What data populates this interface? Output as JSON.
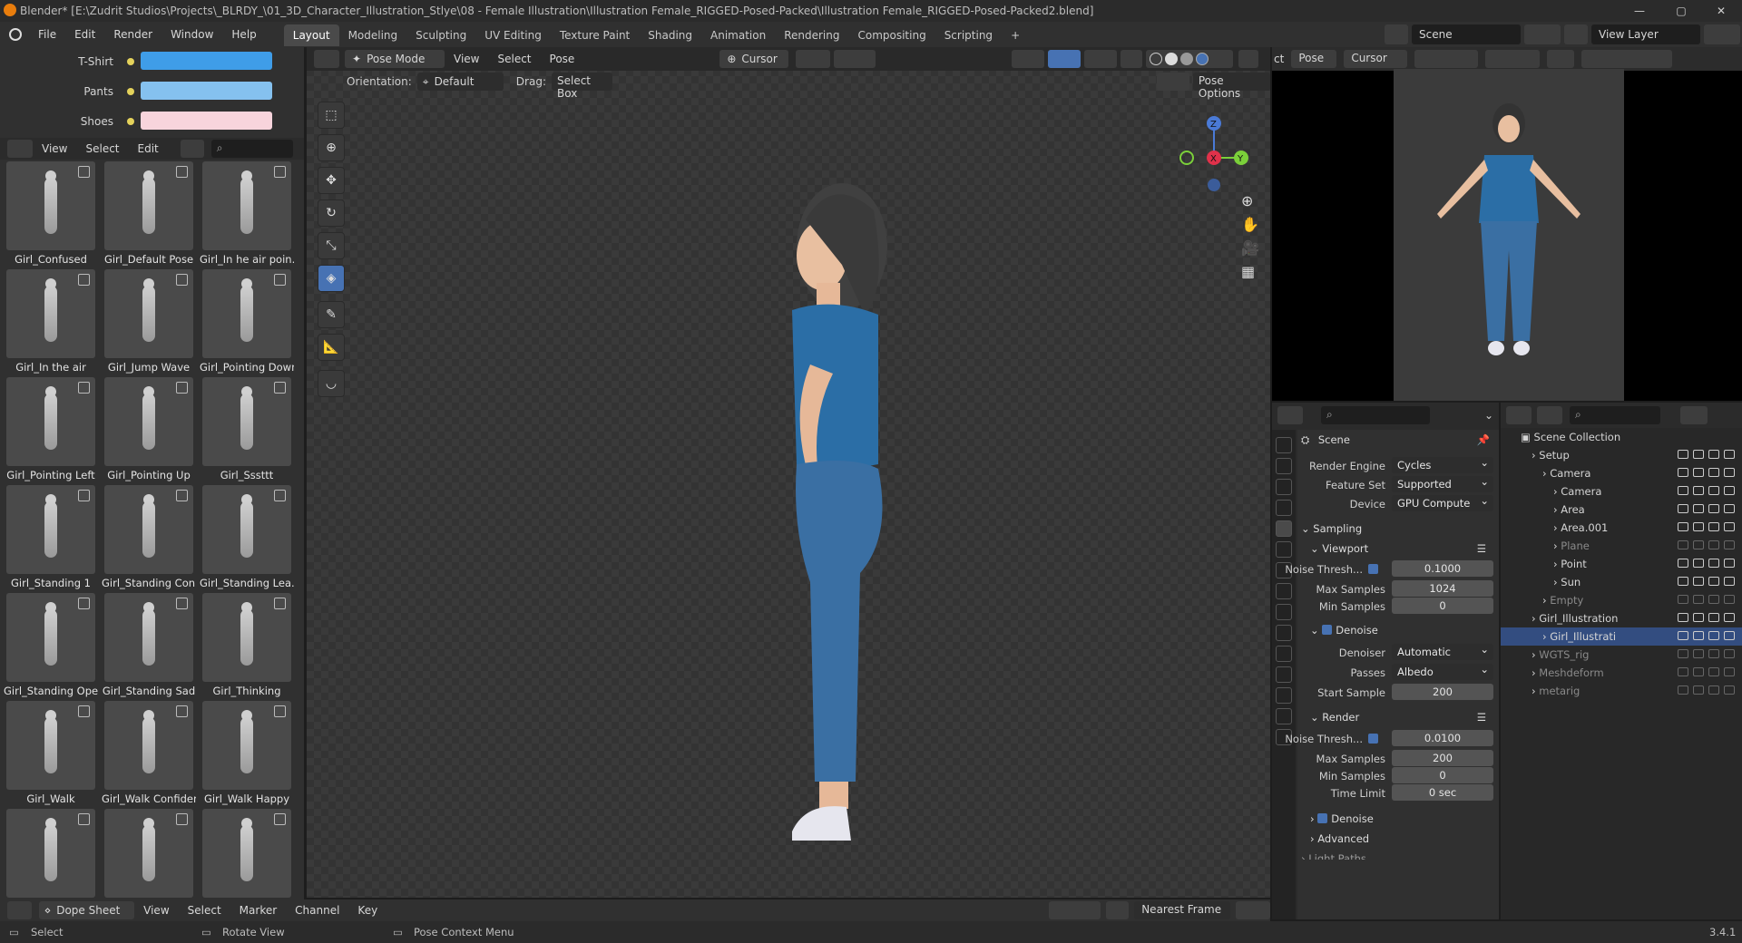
{
  "window": {
    "title": "Blender* [E:\\Zudrit Studios\\Projects\\_BLRDY_\\01_3D_Character_Illustration_Stlye\\08 - Female Illustration\\Illustration Female_RIGGED-Posed-Packed\\Illustration Female_RIGGED-Posed-Packed2.blend]",
    "minimize": "—",
    "maximize": "▢",
    "close": "✕"
  },
  "menubar": {
    "menus": [
      "File",
      "Edit",
      "Render",
      "Window",
      "Help"
    ],
    "workspaces": [
      "Layout",
      "Modeling",
      "Sculpting",
      "UV Editing",
      "Texture Paint",
      "Shading",
      "Animation",
      "Rendering",
      "Compositing",
      "Scripting"
    ],
    "active_workspace": "Layout",
    "add_tab": "+",
    "scene_label": "Scene",
    "view_layer_label": "View Layer"
  },
  "colors_panel": {
    "rows": [
      {
        "label": "T-Shirt",
        "color": "#3f9de8"
      },
      {
        "label": "Pants",
        "color": "#85c1ef"
      },
      {
        "label": "Shoes",
        "color": "#f8d4dc"
      }
    ]
  },
  "asset_browser": {
    "menus": [
      "View",
      "Select",
      "Edit"
    ],
    "poses": [
      "Girl_Confused",
      "Girl_Default Pose",
      "Girl_In he air poin...",
      "Girl_In the air",
      "Girl_Jump Wave",
      "Girl_Pointing Down",
      "Girl_Pointing Left",
      "Girl_Pointing Up",
      "Girl_Sssttt",
      "Girl_Standing 1",
      "Girl_Standing Con...",
      "Girl_Standing Lea...",
      "Girl_Standing Ope...",
      "Girl_Standing Sad",
      "Girl_Thinking",
      "Girl_Walk",
      "Girl_Walk Confident",
      "Girl_Walk Happy",
      "",
      "",
      ""
    ]
  },
  "viewport": {
    "mode": "Pose Mode",
    "menus": [
      "View",
      "Select",
      "Pose"
    ],
    "pivot": "Cursor",
    "orientation_label": "Orientation:",
    "orientation_value": "Default",
    "drag_label": "Drag:",
    "drag_value": "Select Box",
    "pose_options": "Pose Options",
    "gizmo": {
      "z": "Z",
      "x": "X",
      "y": "Y"
    }
  },
  "camera_view": {
    "mode": "Pose",
    "pivot": "Cursor",
    "prefix": "ct"
  },
  "properties": {
    "context": "Scene",
    "rows": {
      "render_engine": {
        "label": "Render Engine",
        "value": "Cycles"
      },
      "feature_set": {
        "label": "Feature Set",
        "value": "Supported"
      },
      "device": {
        "label": "Device",
        "value": "GPU Compute"
      }
    },
    "sampling": "Sampling",
    "viewport_panel": "Viewport",
    "viewport_noise": {
      "label": "Noise Thresh...",
      "value": "0.1000"
    },
    "viewport_max": {
      "label": "Max Samples",
      "value": "1024"
    },
    "viewport_min": {
      "label": "Min Samples",
      "value": "0"
    },
    "denoise": "Denoise",
    "denoiser": {
      "label": "Denoiser",
      "value": "Automatic"
    },
    "passes": {
      "label": "Passes",
      "value": "Albedo"
    },
    "start_sample": {
      "label": "Start Sample",
      "value": "200"
    },
    "render_panel": "Render",
    "render_noise": {
      "label": "Noise Thresh...",
      "value": "0.0100"
    },
    "render_max": {
      "label": "Max Samples",
      "value": "200"
    },
    "render_min": {
      "label": "Min Samples",
      "value": "0"
    },
    "time_limit": {
      "label": "Time Limit",
      "value": "0 sec"
    },
    "render_denoise": "Denoise",
    "advanced": "Advanced",
    "light_paths": "Light Paths"
  },
  "outliner": {
    "root": "Scene Collection",
    "items": [
      {
        "name": "Setup",
        "depth": 1,
        "dim": false,
        "sel": false
      },
      {
        "name": "Camera",
        "depth": 2,
        "dim": false,
        "sel": false
      },
      {
        "name": "Camera",
        "depth": 3,
        "dim": false,
        "sel": false
      },
      {
        "name": "Area",
        "depth": 3,
        "dim": false,
        "sel": false
      },
      {
        "name": "Area.001",
        "depth": 3,
        "dim": false,
        "sel": false
      },
      {
        "name": "Plane",
        "depth": 3,
        "dim": true,
        "sel": false
      },
      {
        "name": "Point",
        "depth": 3,
        "dim": false,
        "sel": false
      },
      {
        "name": "Sun",
        "depth": 3,
        "dim": false,
        "sel": false
      },
      {
        "name": "Empty",
        "depth": 2,
        "dim": true,
        "sel": false
      },
      {
        "name": "Girl_Illustration",
        "depth": 1,
        "dim": false,
        "sel": false
      },
      {
        "name": "Girl_Illustrati",
        "depth": 2,
        "dim": false,
        "sel": true
      },
      {
        "name": "WGTS_rig",
        "depth": 1,
        "dim": true,
        "sel": false
      },
      {
        "name": "Meshdeform",
        "depth": 1,
        "dim": true,
        "sel": false
      },
      {
        "name": "metarig",
        "depth": 1,
        "dim": true,
        "sel": false
      }
    ]
  },
  "dopesheet": {
    "editor": "Dope Sheet",
    "menus": [
      "View",
      "Select",
      "Marker",
      "Channel",
      "Key"
    ],
    "snap": "Nearest Frame"
  },
  "statusbar": {
    "select": "Select",
    "rotate": "Rotate View",
    "context_menu": "Pose Context Menu",
    "version": "3.4.1"
  }
}
